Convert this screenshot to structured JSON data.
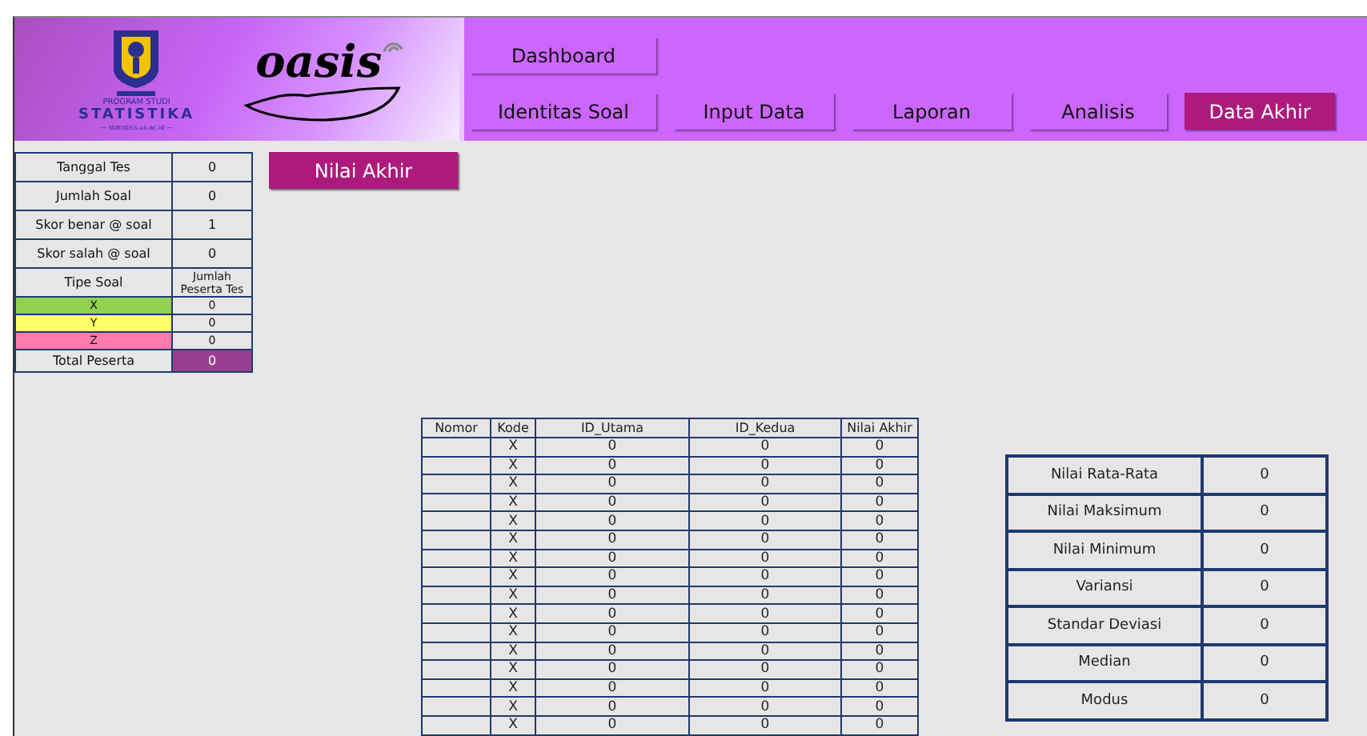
{
  "brand": {
    "program": "PROGRAM STUDI",
    "department": "STATISTIKA",
    "website": "— statistics.uii.ac.id —",
    "app_name": "oasis"
  },
  "nav": {
    "dashboard": "Dashboard",
    "tabs": [
      {
        "label": "Identitas Soal",
        "selected": false
      },
      {
        "label": "Input Data",
        "selected": false
      },
      {
        "label": "Laporan",
        "selected": false
      },
      {
        "label": "Analisis",
        "selected": false
      },
      {
        "label": "Data Akhir",
        "selected": true
      }
    ]
  },
  "settings": [
    {
      "label": "Tanggal Tes",
      "value": "0"
    },
    {
      "label": "Jumlah Soal",
      "value": "0"
    },
    {
      "label": "Skor benar @ soal",
      "value": "1"
    },
    {
      "label": "Skor salah @ soal",
      "value": "0"
    }
  ],
  "type_header": {
    "label": "Tipe Soal",
    "count_label": "Jumlah Peserta Tes"
  },
  "types": [
    {
      "label": "X",
      "count": "0",
      "color": "#92d050"
    },
    {
      "label": "Y",
      "count": "0",
      "color": "#ffff66"
    },
    {
      "label": "Z",
      "count": "0",
      "color": "#ff7bac"
    }
  ],
  "total": {
    "label": "Total Peserta",
    "value": "0"
  },
  "page_button": "Nilai Akhir",
  "results": {
    "columns": [
      "Nomor",
      "Kode",
      "ID_Utama",
      "ID_Kedua",
      "Nilai Akhir"
    ],
    "rows": [
      [
        "",
        "X",
        "0",
        "0",
        "0"
      ],
      [
        "",
        "X",
        "0",
        "0",
        "0"
      ],
      [
        "",
        "X",
        "0",
        "0",
        "0"
      ],
      [
        "",
        "X",
        "0",
        "0",
        "0"
      ],
      [
        "",
        "X",
        "0",
        "0",
        "0"
      ],
      [
        "",
        "X",
        "0",
        "0",
        "0"
      ],
      [
        "",
        "X",
        "0",
        "0",
        "0"
      ],
      [
        "",
        "X",
        "0",
        "0",
        "0"
      ],
      [
        "",
        "X",
        "0",
        "0",
        "0"
      ],
      [
        "",
        "X",
        "0",
        "0",
        "0"
      ],
      [
        "",
        "X",
        "0",
        "0",
        "0"
      ],
      [
        "",
        "X",
        "0",
        "0",
        "0"
      ],
      [
        "",
        "X",
        "0",
        "0",
        "0"
      ],
      [
        "",
        "X",
        "0",
        "0",
        "0"
      ],
      [
        "",
        "X",
        "0",
        "0",
        "0"
      ],
      [
        "",
        "X",
        "0",
        "0",
        "0"
      ]
    ]
  },
  "statistics": [
    {
      "label": "Nilai Rata-Rata",
      "value": "0"
    },
    {
      "label": "Nilai Maksimum",
      "value": "0"
    },
    {
      "label": "Nilai Minimum",
      "value": "0"
    },
    {
      "label": "Variansi",
      "value": "0"
    },
    {
      "label": "Standar Deviasi",
      "value": "0"
    },
    {
      "label": "Median",
      "value": "0"
    },
    {
      "label": "Modus",
      "value": "0"
    }
  ]
}
